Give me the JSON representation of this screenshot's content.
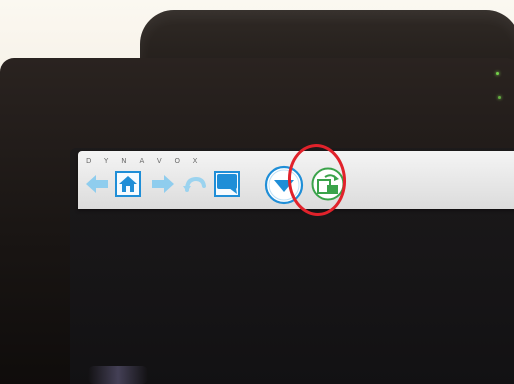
{
  "brand": {
    "text": "DYNAVOX"
  },
  "toolbar": {
    "buttons": [
      {
        "name": "back",
        "icon": "arrow-left-icon",
        "color": "#7fc4ea",
        "selected": false
      },
      {
        "name": "home",
        "icon": "home-icon",
        "color": "#1f8ed7",
        "selected": true
      },
      {
        "name": "forward",
        "icon": "arrow-right-icon",
        "color": "#7fc4ea",
        "selected": false
      },
      {
        "name": "undo",
        "icon": "undo-icon",
        "color": "#7fc4ea",
        "selected": false
      },
      {
        "name": "chat",
        "icon": "speech-bubble-icon",
        "color": "#1f8ed7",
        "selected": true
      },
      {
        "name": "menu",
        "icon": "chevron-down-circle-icon",
        "color": "#1f8ed7",
        "selected": false,
        "highlighted": true
      },
      {
        "name": "rotate",
        "icon": "screen-rotate-icon",
        "color": "#3aa34a",
        "selected": false
      }
    ]
  },
  "annotation": {
    "shape": "circle",
    "color": "#e1222b",
    "target": "menu"
  },
  "colors": {
    "accent": "#1f8ed7",
    "device": "#1f1a17",
    "annotation": "#e1222b"
  }
}
